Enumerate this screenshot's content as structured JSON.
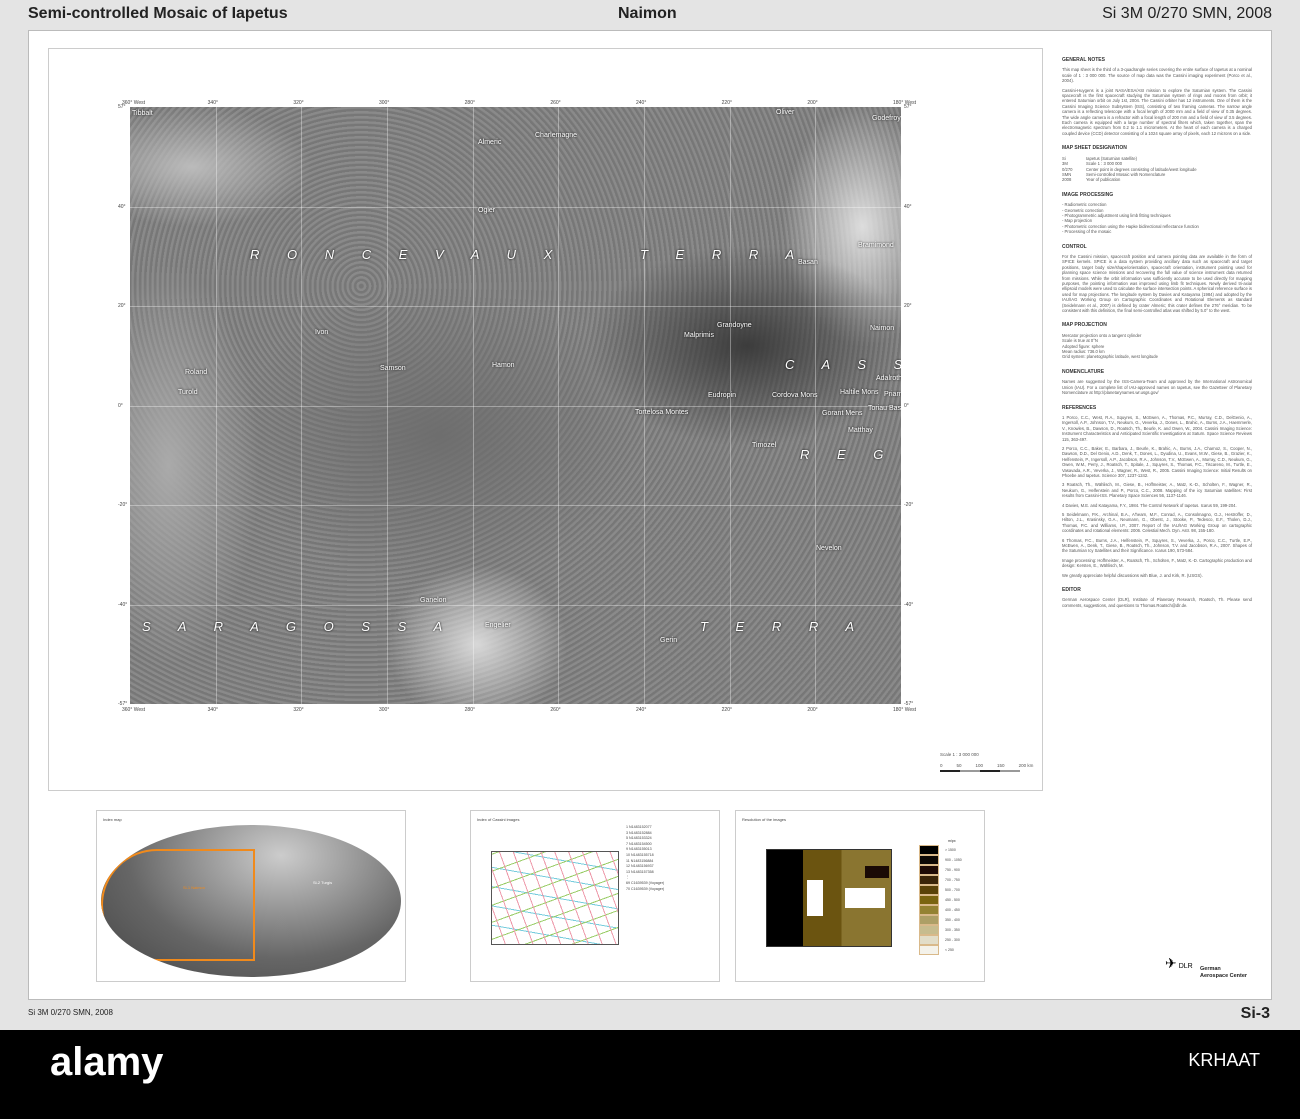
{
  "header": {
    "left": "Semi-controlled Mosaic of Iapetus",
    "center": "Naimon",
    "right": "Si 3M 0/270 SMN, 2008"
  },
  "map": {
    "lon_ticks": [
      "360° West",
      "340°",
      "320°",
      "300°",
      "280°",
      "260°",
      "240°",
      "220°",
      "200°",
      "180° West"
    ],
    "lat_ticks": [
      "57°",
      "40°",
      "20°",
      "0°",
      "-20°",
      "-40°",
      "-57°"
    ],
    "regions": [
      "R O N C E V A U X",
      "T E R R A",
      "C A S S I N I",
      "R E G I O",
      "S A R A G O S S A",
      "T E R R A"
    ],
    "features": [
      "Tibbalt",
      "Almeric",
      "Charlemagne",
      "Oliver",
      "Godefroy",
      "Ogier",
      "Bramimond",
      "Basan",
      "Ivon",
      "Turold",
      "Roland",
      "Samson",
      "Hamon",
      "Grandoyne",
      "Malprimis",
      "Eudropin",
      "Adalroth",
      "Haltile Mons",
      "Priamon",
      "Cordova Mons",
      "Tortelosa Montes",
      "Toriau Basile",
      "Gorant Mens",
      "Matthay",
      "Timozel",
      "Naimon",
      "Nevelon",
      "Engelier",
      "Gerin",
      "Ganelon"
    ],
    "scale": {
      "label": "Scale 1 : 3 000 000",
      "ticks": [
        "0",
        "50",
        "100",
        "150",
        "200 km"
      ]
    }
  },
  "notes": {
    "general_title": "GENERAL NOTES",
    "general_1": "This map sheet is the third of a 3-quadrangle series covering the entire surface of Iapetus at a nominal scale of 1 : 3 000 000. The source of map data was the Cassini imaging experiment (Porco et al., 2004).",
    "general_2": "Cassini-Huygens is a joint NASA/ESA/ASI mission to explore the Saturnian system. The Cassini spacecraft is the first spacecraft studying the Saturnian system of rings and moons from orbit; it entered Saturnian orbit on July 1st, 2004. The Cassini orbiter has 12 instruments. One of them is the Cassini Imaging Science Subsystem (ISS), consisting of two framing cameras. The narrow angle camera is a reflecting telescope with a focal length of 2000 mm and a field of view of 0.35 degrees. The wide angle camera is a refractor with a focal length of 200 mm and a field of view of 3.5 degrees. Each camera is equipped with a large number of spectral filters which, taken together, span the electromagnetic spectrum from 0.2 to 1.1 micrometers. At the heart of each camera is a charged coupled device (CCD) detector consisting of a 1024 square array of pixels, each 12 microns on a side.",
    "designation_title": "MAP SHEET DESIGNATION",
    "designation": [
      [
        "Si",
        "Iapetus (Saturnian satellite)"
      ],
      [
        "3M",
        "Scale 1 : 3 000 000"
      ],
      [
        "0/270",
        "Center point in degrees consisting of latitude/west longitude"
      ],
      [
        "SMN",
        "Semi-controlled Mosaic with Nomenclature"
      ],
      [
        "2008",
        "Year of publication"
      ]
    ],
    "processing_title": "IMAGE PROCESSING",
    "processing": [
      "- Radiometric correction",
      "- Geometric correction",
      "- Photogrammetric adjustment using limb fitting techniques",
      "- Map projection",
      "- Photometric correction using the Hapke bidirectional reflectance function",
      "- Processing of the mosaic"
    ],
    "control_title": "CONTROL",
    "control": "For the Cassini mission, spacecraft position and camera pointing data are available in the form of SPICE kernels. SPICE is a data system providing ancillary data such as spacecraft and target positions, target body size/shape/orientation, spacecraft orientation, instrument pointing used for planning space science missions and recovering the full value of science instrument data returned from missions. While the orbit information was sufficiently accurate to be used directly for mapping purposes, the pointing information was improved using limb fit techniques. Newly derived tri-axial ellipsoid models were used to calculate the surface intersection points. A spherical reference surface is used for map projections. The longitude system by Davies and Katayama (1984) and adopted by the IAU/IAG Working Group on Cartographic Coordinates and Rotational Elements as standard (Seidelmann et al., 2007) is defined by crater Almeric; this crater defines the 276° meridian. To be consistent with this definition, the final semi-controlled atlas was shifted by 5.0° to the west.",
    "projection_title": "MAP PROJECTION",
    "projection": [
      "Mercator projection onto a tangent cylinder",
      "Scale is true at 0°N",
      "Adopted figure: sphere",
      "Mean radius: 736.0 km",
      "Grid system: planetographic latitude, west longitude"
    ],
    "nomenclature_title": "NOMENCLATURE",
    "nomenclature": "Names are suggested by the ISS-Camera-Team and approved by the International Astronomical Union (IAU). For a complete list of IAU-approved names on Iapetus, see the Gazetteer of Planetary Nomenclature at http://planetarynames.wr.usgs.gov/",
    "references_title": "REFERENCES",
    "references": [
      "1 Porco, C.C., West, R.A., Squyres, S., McEwen, A., Thomas, P.C., Murray, C.D., DelGenio, A., Ingersoll, A.P., Johnson, T.V., Neukum, G., Veverka, J., Dones, L., Brahic, A., Burns, J.A., Haemmerle, V., Knowles, B., Dawson, D., Roatsch, Th., Beurle, K. and Owen, W., 2004. Cassini Imaging Science: Instrument Characteristics and Anticipated Scientific Investigations at Saturn. Space Science Reviews 115, 363-497.",
      "2 Porco, C.C., Baker, E., Barbara, J., Beurle, K., Brahic, A., Burns, J.A., Charnoz, S., Cooper, N., Dawson, D.D., Del Genio, A.D., Denk, T., Dones, L., Dyudina, U., Evans, M.W., Giese, B., Grazier, K., Helfenstein, P., Ingersoll, A.P., Jacobson, R.A., Johnson, T.V., McEwen, A., Murray, C.D., Neukum, G., Owen, W.M., Perry, J., Roatsch, T., Spitale, J., Squyres, S., Thomas, P.C., Tiscareno, M., Turtle, E., Vasavada, A.R., Veverka, J., Wagner, R., West, R., 2005. Cassini Imaging Science: Initial Results on Phoebe and Iapetus. Science 307, 1237-1242.",
      "3 Roatsch, Th., Wählisch, M., Giese, B., Hoffmeister, A., Matz, K.-D., Scholten, F., Wagner, R., Neukum, G., Helfenstein and P., Porco, C.C., 2008. Mapping of the icy Saturnian satellites: First results from Cassini-ISS. Planetary Space Sciences 56, 1137-1146.",
      "4 Davies, M.E. and Katayama, F.Y., 1984. The Control Network of Iapetus. Icarus 59, 199-204.",
      "5 Seidelmann, P.K., Archinal, B.A., A'hearn, M.F., Conrad, A., Consolmagno, G.J., Hestroffer, D., Hilton, J.L., Krasinsky, G.A., Neumann, G., Oberst, J., Stooke, P., Tedesco, E.F., Tholen, D.J., Thomas, P.C. and Williams, I.P., 2007. Report of the IAU/IAG Working Group on cartographic coordinates and rotational elements: 2006. Celestial Mech. Dyn. Astr. 98, 155-180.",
      "6 Thomas, P.C., Burns, J.A., Helfenstein, P., Squyres, S., Veverka, J., Porco, C.C., Turtle, E.P., McEwen, A., Denk, T., Giese, B., Roatsch, Th., Johnson, T.V. and Jacobson, R.A., 2007. Shapes of the Saturnian Icy Satellites and their Significance. Icarus 190, 573-584."
    ],
    "credits": "Image processing: Hoffmeister, A., Roatsch, Th., Scholten, F., Matz, K.-D. Cartographic production and design: Kersten, E., Wählisch, M.",
    "thanks": "We greatly appreciate helpful discussions with Blue, J. and Kirk, R. (USGS).",
    "editor_title": "EDITOR",
    "editor": "German Aerospace Center (DLR), Institute of Planetary Research, Roatsch, Th. Please send comments, suggestions, and questions to Thomas.Roatsch@dlr.de."
  },
  "panels": {
    "index_map": {
      "title": "Index map",
      "labels": [
        "Si-1 Naimon",
        "Si-2 Turgis"
      ]
    },
    "cassini_images": {
      "title": "Index of Cassini images",
      "first_col": [
        "1 N1483152077",
        "3 N1483152884",
        "5 N1483153324",
        "7 N1483154500",
        "9 N1483155013",
        "10 N1483155718",
        "11 N1483156884",
        "12 N1483156937",
        "13 N1483157358"
      ],
      "last": [
        "69 C1639539 (Voyager)",
        "70 C1639539 (Voyager)"
      ]
    },
    "resolution": {
      "title": "Resolution of the images",
      "unit": "m/px",
      "legend": [
        "> 1500",
        "900 - 1050",
        "750 - 900",
        "700 - 750",
        "500 - 700",
        "450 - 500",
        "400 - 450",
        "350 - 400",
        "300 - 350",
        "250 - 300",
        "< 250"
      ],
      "colors": [
        "#000000",
        "#0d0805",
        "#1e0a05",
        "#3a2408",
        "#5a4208",
        "#7a6410",
        "#948232",
        "#ad9f66",
        "#c7bc8e",
        "#e2ddc8",
        "#f4f2ea"
      ]
    }
  },
  "logo": {
    "abbr": "DLR",
    "line1": "German",
    "line2": "Aerospace Center"
  },
  "footer": {
    "left": "Si 3M 0/270 SMN, 2008",
    "right": "Si-3"
  },
  "watermark": {
    "brand": "alamy",
    "id": "KRHAAT"
  }
}
